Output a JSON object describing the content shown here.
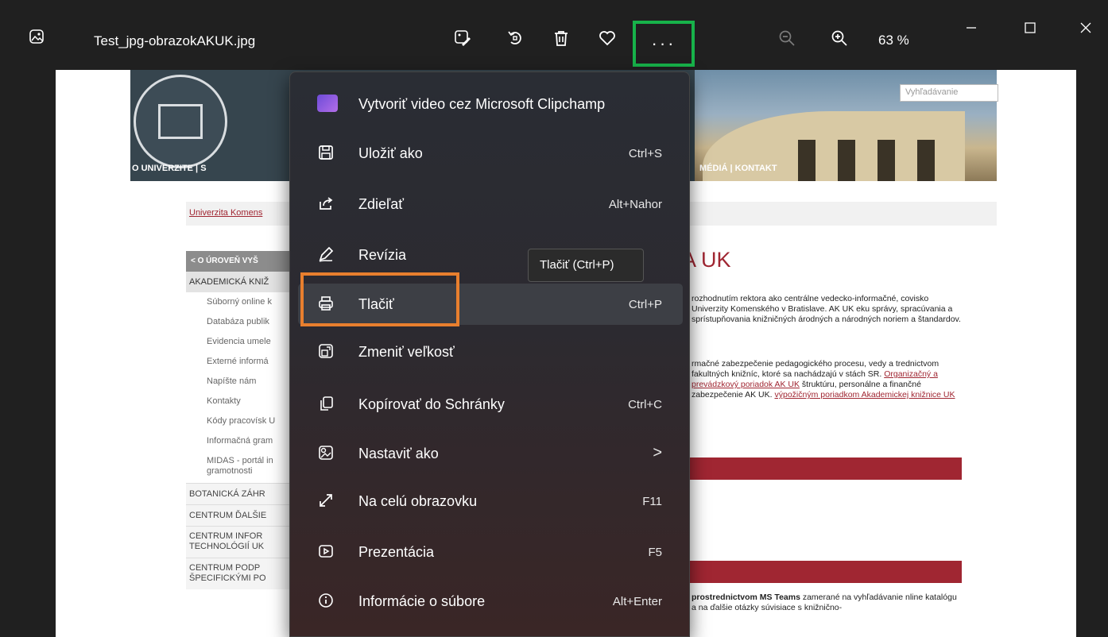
{
  "window": {
    "file_name": "Test_jpg-obrazokAKUK.jpg",
    "zoom_level": "63 %",
    "more_label": "···"
  },
  "colors": {
    "more_highlight": "#17b34a",
    "print_highlight": "#e87f2e",
    "site_accent": "#a02632"
  },
  "icons": {
    "app": "image-icon",
    "edit": "edit-image-icon",
    "rotate": "rotate-icon",
    "delete": "trash-icon",
    "favorite": "heart-icon",
    "zoom_out": "zoom-out-icon",
    "zoom_in": "zoom-in-icon"
  },
  "menu": {
    "items": [
      {
        "label": "Vytvoriť video cez Microsoft Clipchamp",
        "shortcut": "",
        "icon": "clipchamp-icon"
      },
      {
        "label": "Uložiť ako",
        "shortcut": "Ctrl+S",
        "icon": "save-icon"
      },
      {
        "label": "Zdieľať",
        "shortcut": "Alt+Nahor",
        "icon": "share-icon"
      },
      {
        "label": "Revízia",
        "shortcut": "",
        "icon": "pen-icon"
      },
      {
        "label": "Tlačiť",
        "shortcut": "Ctrl+P",
        "icon": "print-icon"
      },
      {
        "label": "Zmeniť veľkosť",
        "shortcut": "",
        "icon": "resize-icon"
      },
      {
        "label": "Kopírovať do Schránky",
        "shortcut": "Ctrl+C",
        "icon": "copy-icon"
      },
      {
        "label": "Nastaviť ako",
        "shortcut": ">",
        "icon": "set-as-icon"
      },
      {
        "label": "Na celú obrazovku",
        "shortcut": "F11",
        "icon": "fullscreen-icon"
      },
      {
        "label": "Prezentácia",
        "shortcut": "F5",
        "icon": "slideshow-icon"
      },
      {
        "label": "Informácie o súbore",
        "shortcut": "Alt+Enter",
        "icon": "info-icon"
      }
    ],
    "tooltip": "Tlačiť (Ctrl+P)"
  },
  "website": {
    "search_placeholder": "Vyhľadávanie",
    "nav_left": "O UNIVERZITE  |  S",
    "nav_right": "MÉDIÁ  |  KONTAKT",
    "breadcrumb": "Univerzita Komens",
    "heading": "A UK",
    "sidebar": {
      "back": "O ÚROVEŇ VYŠ",
      "current": "AKADEMICKÁ KNIŽ",
      "items": [
        "Súborný online k",
        "Databáza publik",
        "Evidencia umele",
        "Externé informá",
        "Napíšte nám",
        "Kontakty",
        "Kódy pracovísk U",
        "Informačná gram"
      ],
      "item_tall": "MIDAS - portál in gramotnosti",
      "categories": [
        "BOTANICKÁ ZÁHR",
        "CENTRUM ĎALŠIE"
      ],
      "category_tall_1": "CENTRUM INFOR TECHNOLÓGIÍ UK",
      "category_tall_2": "CENTRUM PODP ŠPECIFICKÝMI PO"
    },
    "para1": "rozhodnutím rektora ako centrálne vedecko-informačné, covisko Univerzity Komenského v Bratislave. AK UK eku správy, spracúvania a sprístupňovania knižničných árodných a národných noriem a štandardov.",
    "para2_a": "rmačné zabezpečenie pedagogického procesu, vedy a trednictvom fakultných knižníc, ktoré sa nachádzajú v stách SR.",
    "para2_link": "Organizačný a prevádzkový poriadok AK UK",
    "para2_b": "štruktúru, personálne a finančné zabezpečenie AK UK.",
    "para2_link2": "výpožičným poriadkom Akademickej knižnice UK",
    "para3_bold": "prostrednictvom MS Teams",
    "para3": "zamerané na vyhľadávanie nline katalógu a na ďalšie otázky súvisiace s knižnično-"
  }
}
